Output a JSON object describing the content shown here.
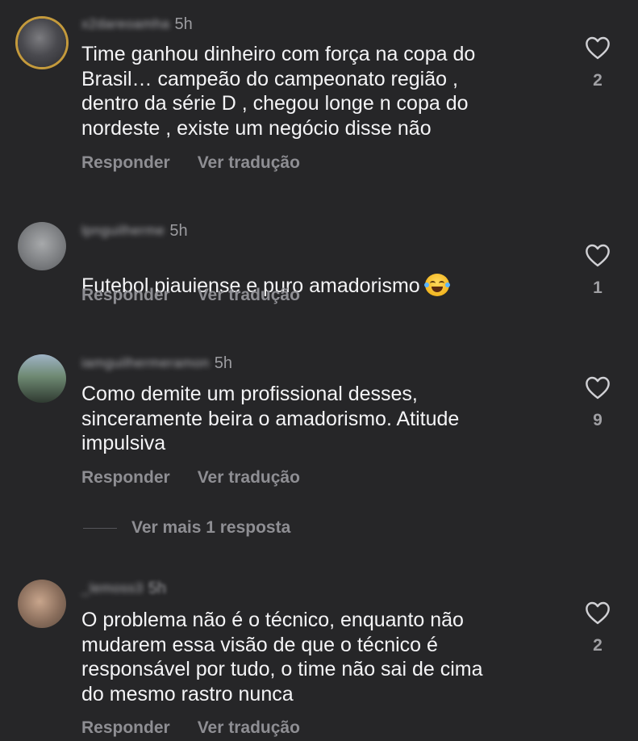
{
  "comments": [
    {
      "username": "x2dareoamha",
      "time": "5h",
      "text": "Time ganhou dinheiro com força na copa do\nBrasil… campeão do campeonato região ,\ndentro da série D , chegou longe n copa do\nnordeste , existe um negócio disse não",
      "reply_label": "Responder",
      "translate_label": "Ver tradução",
      "likes": "2"
    },
    {
      "username": "lpnguilherme",
      "time": "5h",
      "text": "Futebol piauiense e puro amadorismo",
      "emoji": "laughing-tears",
      "reply_label": "Responder",
      "translate_label": "Ver tradução",
      "likes": "1"
    },
    {
      "username": "iamguilhermeramon",
      "time": "5h",
      "text": "Como demite um profissional desses,\nsinceramente beira o amadorismo. Atitude\nimpulsiva",
      "reply_label": "Responder",
      "translate_label": "Ver tradução",
      "likes": "9"
    },
    {
      "username": "_lemoss3",
      "time": "5h",
      "text": "O problema não é o técnico, enquanto não\nmudarem essa visão de que o técnico é\nresponsável por tudo, o time não sai de cima\ndo mesmo rastro nunca",
      "reply_label": "Responder",
      "translate_label": "Ver tradução",
      "likes": "2"
    }
  ],
  "view_more_replies": "Ver mais 1 resposta",
  "colors": {
    "background": "#262628",
    "secondary_text": "#8e8e93",
    "story_ring": "#c49a3c"
  },
  "icons": {
    "like": "heart-outline-icon"
  }
}
